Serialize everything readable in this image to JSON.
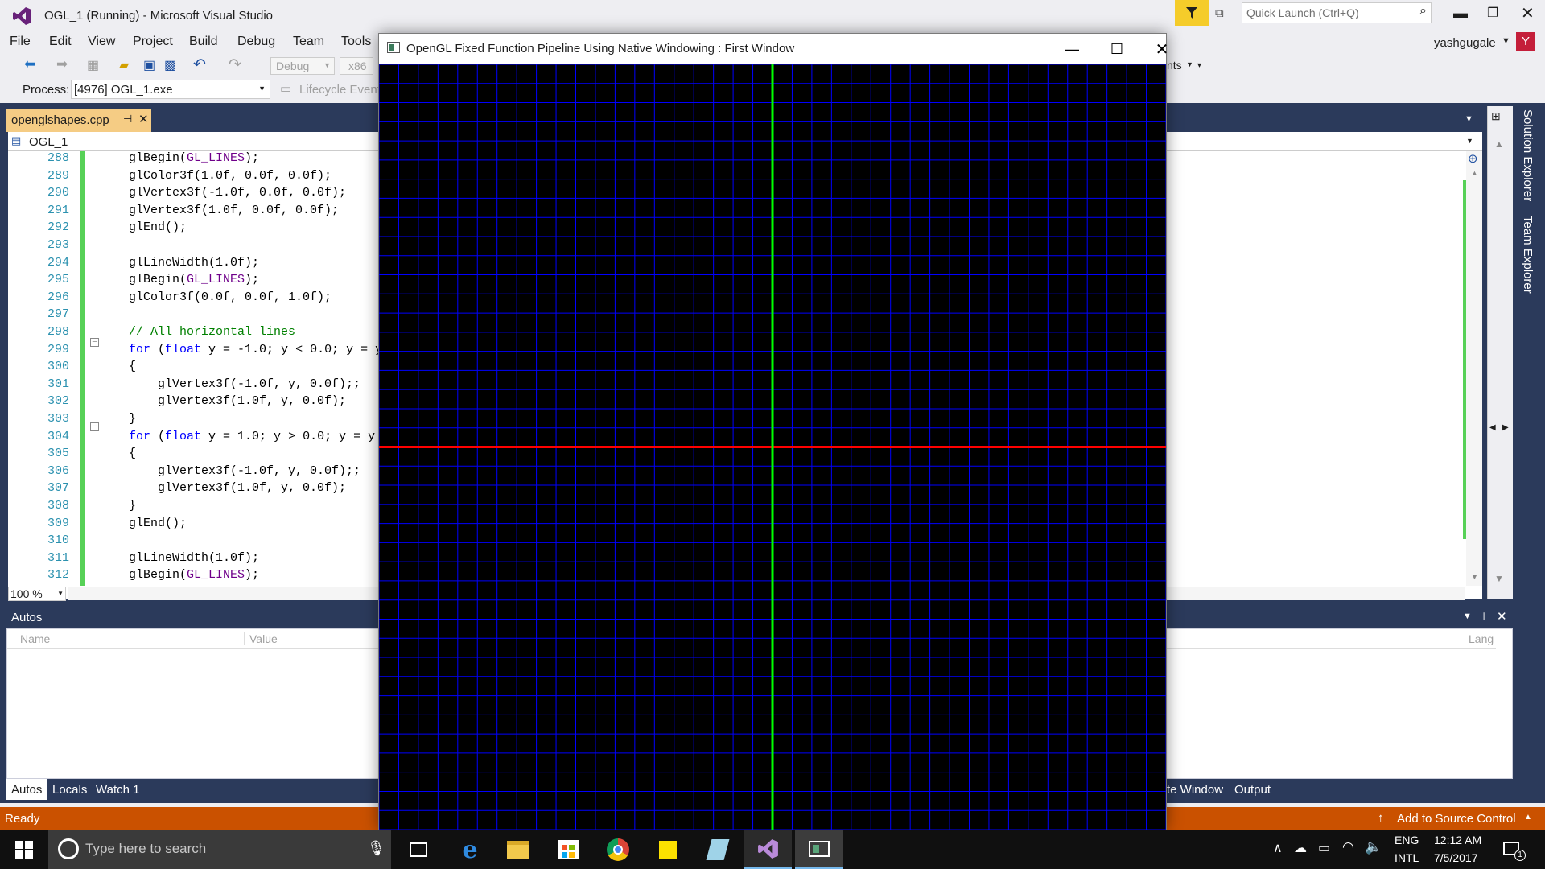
{
  "vs": {
    "title": "OGL_1 (Running) - Microsoft Visual Studio",
    "quick_launch_placeholder": "Quick Launch (Ctrl+Q)",
    "user": "yashgugale",
    "user_initial": "Y",
    "menu": [
      "File",
      "Edit",
      "View",
      "Project",
      "Build",
      "Debug",
      "Team",
      "Tools"
    ],
    "toolbar": {
      "config": "Debug",
      "platform": "x86",
      "overflow_text": "nts"
    },
    "process_label": "Process:",
    "process_value": "[4976] OGL_1.exe",
    "lifecycle_label": "Lifecycle Events",
    "doc_tab": "openglshapes.cpp",
    "nav_scope": "OGL_1",
    "zoom": "100 %",
    "side_tabs": [
      "Solution Explorer",
      "Team Explorer"
    ],
    "code_lines": [
      {
        "n": "288",
        "t": "glBegin(GL_LINES);"
      },
      {
        "n": "289",
        "t": "glColor3f(1.0f, 0.0f, 0.0f);"
      },
      {
        "n": "290",
        "t": "glVertex3f(-1.0f, 0.0f, 0.0f);"
      },
      {
        "n": "291",
        "t": "glVertex3f(1.0f, 0.0f, 0.0f);"
      },
      {
        "n": "292",
        "t": "glEnd();"
      },
      {
        "n": "293",
        "t": ""
      },
      {
        "n": "294",
        "t": "glLineWidth(1.0f);"
      },
      {
        "n": "295",
        "t": "glBegin(GL_LINES);"
      },
      {
        "n": "296",
        "t": "glColor3f(0.0f, 0.0f, 1.0f);"
      },
      {
        "n": "297",
        "t": ""
      },
      {
        "n": "298",
        "t": "// All horizontal lines"
      },
      {
        "n": "299",
        "t": "for (float y = -1.0; y < 0.0; y = y"
      },
      {
        "n": "300",
        "t": "{"
      },
      {
        "n": "301",
        "t": "    glVertex3f(-1.0f, y, 0.0f);;"
      },
      {
        "n": "302",
        "t": "    glVertex3f(1.0f, y, 0.0f);"
      },
      {
        "n": "303",
        "t": "}"
      },
      {
        "n": "304",
        "t": "for (float y = 1.0; y > 0.0; y = y"
      },
      {
        "n": "305",
        "t": "{"
      },
      {
        "n": "306",
        "t": "    glVertex3f(-1.0f, y, 0.0f);;"
      },
      {
        "n": "307",
        "t": "    glVertex3f(1.0f, y, 0.0f);"
      },
      {
        "n": "308",
        "t": "}"
      },
      {
        "n": "309",
        "t": "glEnd();"
      },
      {
        "n": "310",
        "t": ""
      },
      {
        "n": "311",
        "t": "glLineWidth(1.0f);"
      },
      {
        "n": "312",
        "t": "glBegin(GL_LINES);"
      }
    ],
    "autos": {
      "title": "Autos",
      "columns": [
        "Name",
        "Value",
        "Lang"
      ],
      "tabs": [
        "Autos",
        "Locals",
        "Watch 1"
      ],
      "right_tabs": [
        "te Window",
        "Output"
      ]
    },
    "status": {
      "left": "Ready",
      "right": "Add to Source Control"
    }
  },
  "gl_window": {
    "title": "OpenGL Fixed Function Pipeline Using Native Windowing : First Window",
    "colors": {
      "background": "#000000",
      "grid": "#0000ff",
      "x_axis": "#ff0000",
      "y_axis": "#00ff00"
    }
  },
  "taskbar": {
    "search_placeholder": "Type here to search",
    "lang_top": "ENG",
    "lang_bottom": "INTL",
    "time": "12:12 AM",
    "date": "7/5/2017",
    "notification_count": "1"
  }
}
